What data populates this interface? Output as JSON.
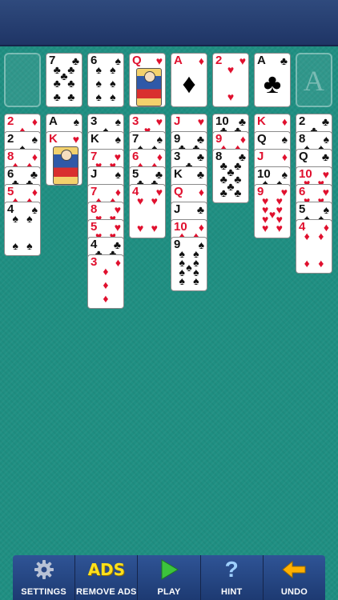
{
  "toolbar": {
    "settings": "SETTINGS",
    "remove_ads_icon": "ADS",
    "remove_ads": "REMOVE ADS",
    "play": "PLAY",
    "hint_icon": "?",
    "hint": "HINT",
    "undo": "UNDO"
  },
  "foundation_empty_letter": "A",
  "free_cells": [
    {
      "empty": true
    },
    {
      "rank": "7",
      "suit": "♣",
      "color": "black"
    },
    {
      "rank": "6",
      "suit": "♠",
      "color": "black"
    },
    {
      "rank": "Q",
      "suit": "♥",
      "color": "red",
      "face": true
    }
  ],
  "foundations": [
    {
      "rank": "A",
      "suit": "♦",
      "color": "red"
    },
    {
      "rank": "2",
      "suit": "♥",
      "color": "red"
    },
    {
      "rank": "A",
      "suit": "♣",
      "color": "black"
    },
    {
      "empty": true
    }
  ],
  "tableau": [
    [
      {
        "rank": "2",
        "suit": "♦",
        "color": "red"
      },
      {
        "rank": "2",
        "suit": "♠",
        "color": "black"
      },
      {
        "rank": "8",
        "suit": "♦",
        "color": "red"
      },
      {
        "rank": "6",
        "suit": "♣",
        "color": "black"
      },
      {
        "rank": "5",
        "suit": "♦",
        "color": "red"
      },
      {
        "rank": "4",
        "suit": "♠",
        "color": "black"
      }
    ],
    [
      {
        "rank": "A",
        "suit": "♠",
        "color": "black"
      },
      {
        "rank": "K",
        "suit": "♥",
        "color": "red",
        "face": true
      }
    ],
    [
      {
        "rank": "3",
        "suit": "♠",
        "color": "black"
      },
      {
        "rank": "K",
        "suit": "♠",
        "color": "black"
      },
      {
        "rank": "7",
        "suit": "♥",
        "color": "red"
      },
      {
        "rank": "J",
        "suit": "♠",
        "color": "black"
      },
      {
        "rank": "7",
        "suit": "♦",
        "color": "red"
      },
      {
        "rank": "8",
        "suit": "♥",
        "color": "red"
      },
      {
        "rank": "5",
        "suit": "♥",
        "color": "red"
      },
      {
        "rank": "4",
        "suit": "♣",
        "color": "black"
      },
      {
        "rank": "3",
        "suit": "♦",
        "color": "red"
      }
    ],
    [
      {
        "rank": "3",
        "suit": "♥",
        "color": "red"
      },
      {
        "rank": "7",
        "suit": "♠",
        "color": "black"
      },
      {
        "rank": "6",
        "suit": "♦",
        "color": "red"
      },
      {
        "rank": "5",
        "suit": "♣",
        "color": "black"
      },
      {
        "rank": "4",
        "suit": "♥",
        "color": "red"
      }
    ],
    [
      {
        "rank": "J",
        "suit": "♥",
        "color": "red"
      },
      {
        "rank": "9",
        "suit": "♣",
        "color": "black"
      },
      {
        "rank": "3",
        "suit": "♣",
        "color": "black"
      },
      {
        "rank": "K",
        "suit": "♣",
        "color": "black"
      },
      {
        "rank": "Q",
        "suit": "♦",
        "color": "red"
      },
      {
        "rank": "J",
        "suit": "♣",
        "color": "black"
      },
      {
        "rank": "10",
        "suit": "♦",
        "color": "red"
      },
      {
        "rank": "9",
        "suit": "♠",
        "color": "black"
      }
    ],
    [
      {
        "rank": "10",
        "suit": "♣",
        "color": "black"
      },
      {
        "rank": "9",
        "suit": "♦",
        "color": "red"
      },
      {
        "rank": "8",
        "suit": "♣",
        "color": "black"
      }
    ],
    [
      {
        "rank": "K",
        "suit": "♦",
        "color": "red"
      },
      {
        "rank": "Q",
        "suit": "♠",
        "color": "black"
      },
      {
        "rank": "J",
        "suit": "♦",
        "color": "red"
      },
      {
        "rank": "10",
        "suit": "♠",
        "color": "black"
      },
      {
        "rank": "9",
        "suit": "♥",
        "color": "red"
      }
    ],
    [
      {
        "rank": "2",
        "suit": "♣",
        "color": "black"
      },
      {
        "rank": "8",
        "suit": "♠",
        "color": "black"
      },
      {
        "rank": "Q",
        "suit": "♣",
        "color": "black"
      },
      {
        "rank": "10",
        "suit": "♥",
        "color": "red"
      },
      {
        "rank": "6",
        "suit": "♥",
        "color": "red"
      },
      {
        "rank": "5",
        "suit": "♠",
        "color": "black"
      },
      {
        "rank": "4",
        "suit": "♦",
        "color": "red"
      }
    ]
  ]
}
